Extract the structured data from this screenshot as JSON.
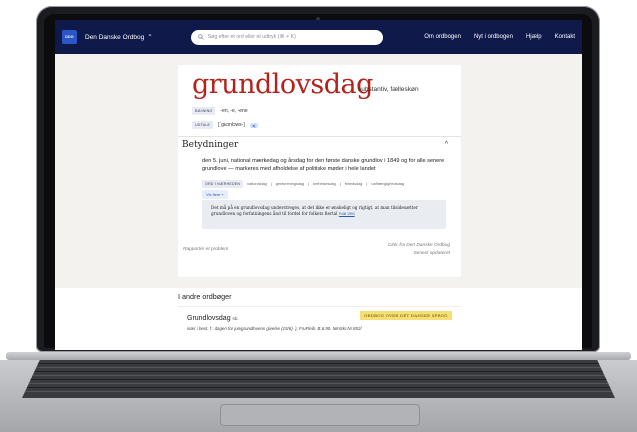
{
  "nav": {
    "logo": "DDO",
    "brand": "Den Danske Ordbog",
    "brand_caret": "⌃",
    "search_placeholder": "Søg efter et ord eller et udtryk (⌘ + K)",
    "links": [
      "Om ordbogen",
      "Nyt i ordbogen",
      "Hjælp",
      "Kontakt"
    ]
  },
  "entry": {
    "headword": "grundlovsdag",
    "pos": "substantiv, fælleskøn",
    "boejning_label": "BØJNING",
    "boejning": "-en, -e, -ene",
    "udtale_label": "UDTALE",
    "udtale": "[ˈgʁɔnlɔws-]",
    "speaker": "◂)"
  },
  "meanings": {
    "title": "Betydninger",
    "chevron": "^",
    "definition": "den 5. juni, national mærkedag og årsdag for den første danske grundlov i 1849 og for alle senere grundlove — markeres med afholdelse af politiske møder i hele landet",
    "related_label": "ORD I NÆRHEDEN",
    "related": [
      "nationaldag",
      "genforeningsdag",
      "befrielsesdag",
      "frihedsdag",
      "uafhængighedsdag"
    ],
    "more": "Vis flere +",
    "example": "Det må på en grundlovsdag understreges, at det ikke er ønskeligt og rigtigt, at man tilsidesætter grundloven og forfatningens ånd til fordel for folkets flertal",
    "example_source": "Politi 1993"
  },
  "footer": {
    "report": "Rapportér et problem",
    "cite": "Citér fra Den Danske Ordbog",
    "updated": "Senest opdateret"
  },
  "others": {
    "title": "I andre ordbøger",
    "word": "Grundlovsdag",
    "word_pos": "sb.",
    "definition": "især i best. f.: dagen for junigrundlovens givelse (15/6). ), FruFleib. B.6.90. MinSkr.Nr.852/",
    "badge": "ORDBOG OVER DET DANSKE SPROG"
  }
}
